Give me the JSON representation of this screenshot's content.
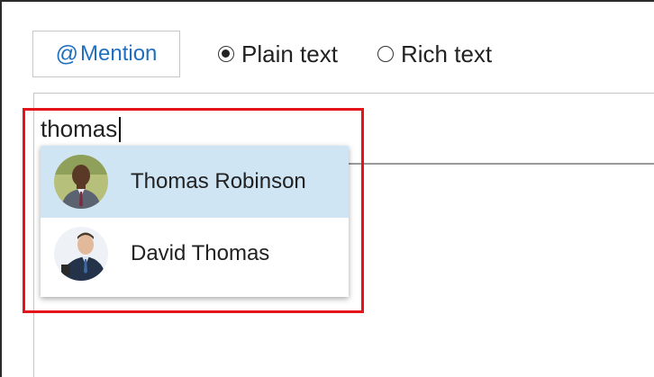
{
  "toolbar": {
    "mention_symbol": "@",
    "mention_label": "Mention",
    "format_options": [
      {
        "label": "Plain text",
        "selected": true
      },
      {
        "label": "Rich text",
        "selected": false
      }
    ]
  },
  "editor": {
    "typed_value": "thomas"
  },
  "suggestions": [
    {
      "name": "Thomas Robinson",
      "highlighted": true,
      "avatar": "user-avatar"
    },
    {
      "name": "David Thomas",
      "highlighted": false,
      "avatar": "user-avatar"
    }
  ],
  "colors": {
    "link_blue": "#1f6fbf",
    "highlight_red": "#e4141b",
    "selected_row": "#cfe5f4"
  }
}
